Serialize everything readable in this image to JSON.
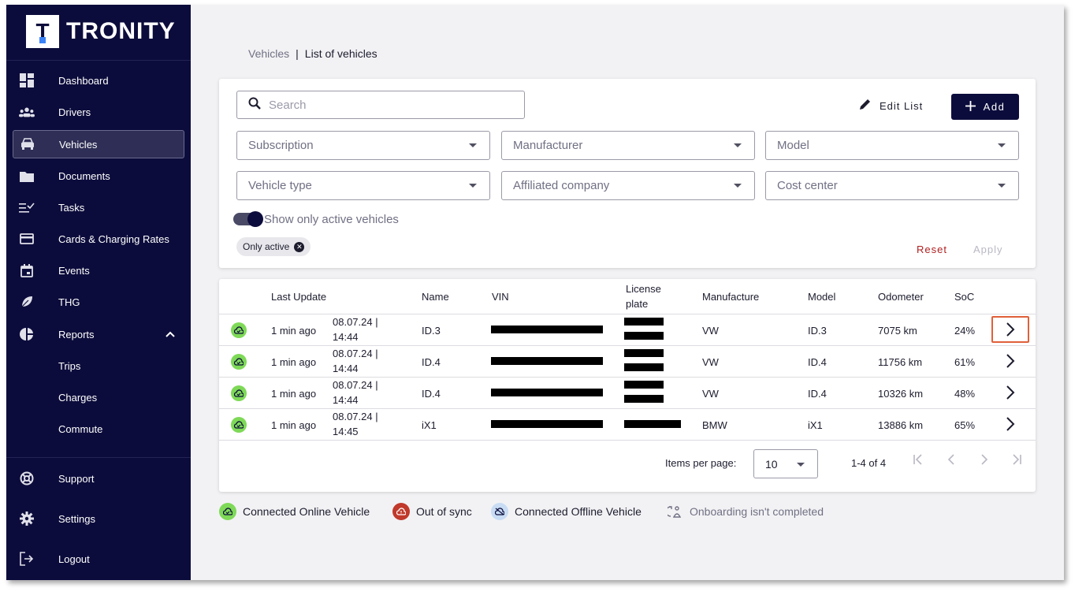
{
  "app": {
    "logo_letter": "T",
    "logo_text": "TRONITY"
  },
  "sidebar": {
    "items": [
      {
        "label": "Dashboard",
        "icon": "dashboard-icon"
      },
      {
        "label": "Drivers",
        "icon": "people-icon"
      },
      {
        "label": "Vehicles",
        "icon": "car-icon",
        "active": true
      },
      {
        "label": "Documents",
        "icon": "folder-icon"
      },
      {
        "label": "Tasks",
        "icon": "checklist-icon"
      },
      {
        "label": "Cards & Charging Rates",
        "icon": "card-icon"
      },
      {
        "label": "Events",
        "icon": "calendar-icon"
      },
      {
        "label": "THG",
        "icon": "leaf-icon"
      },
      {
        "label": "Reports",
        "icon": "pie-chart-icon",
        "expanded": true
      },
      {
        "label": "Trips"
      },
      {
        "label": "Charges"
      },
      {
        "label": "Commute"
      }
    ],
    "bottom": [
      {
        "label": "Support",
        "icon": "lifebuoy-icon"
      },
      {
        "label": "Settings",
        "icon": "gear-icon"
      },
      {
        "label": "Logout",
        "icon": "logout-icon"
      }
    ]
  },
  "breadcrumb": {
    "parent": "Vehicles",
    "separator": "|",
    "current": "List of vehicles"
  },
  "filters": {
    "search_placeholder": "Search",
    "edit_list": "Edit List",
    "add": "Add",
    "subscription": "Subscription",
    "manufacturer": "Manufacturer",
    "model": "Model",
    "vehicle_type": "Vehicle type",
    "affiliated_company": "Affiliated company",
    "cost_center": "Cost center",
    "toggle_label": "Show only active vehicles",
    "toggle_on": true,
    "chip": "Only active",
    "reset": "Reset",
    "apply": "Apply"
  },
  "table": {
    "headers": {
      "last_update": "Last Update",
      "name": "Name",
      "vin": "VIN",
      "license_line1": "License",
      "license_line2": "plate",
      "manufacture": "Manufacture",
      "model": "Model",
      "odometer": "Odometer",
      "soc": "SoC"
    },
    "rows": [
      {
        "ago": "1 min ago",
        "date": "08.07.24 |",
        "time": "14:44",
        "name": "ID.3",
        "manufacture": "VW",
        "model": "ID.3",
        "odometer": "7075 km",
        "soc": "24%"
      },
      {
        "ago": "1 min ago",
        "date": "08.07.24 |",
        "time": "14:44",
        "name": "ID.4",
        "manufacture": "VW",
        "model": "ID.4",
        "odometer": "11756 km",
        "soc": "61%"
      },
      {
        "ago": "1 min ago",
        "date": "08.07.24 |",
        "time": "14:44",
        "name": "ID.4",
        "manufacture": "VW",
        "model": "ID.4",
        "odometer": "10326 km",
        "soc": "48%"
      },
      {
        "ago": "1 min ago",
        "date": "08.07.24 |",
        "time": "14:45",
        "name": "iX1",
        "manufacture": "BMW",
        "model": "iX1",
        "odometer": "13886 km",
        "soc": "65%"
      }
    ],
    "pager": {
      "label": "Items per page:",
      "per_page": "10",
      "range": "1-4 of 4"
    }
  },
  "legend": {
    "online": "Connected Online Vehicle",
    "out_of_sync": "Out of sync",
    "offline": "Connected Offline Vehicle",
    "onboarding": "Onboarding isn't completed"
  },
  "colors": {
    "sidebar_bg": "#0c0c3c",
    "online_green": "#7ed957",
    "out_of_sync_red": "#c0392b",
    "offline_blue": "#c8dcf4",
    "reset_red": "#b02020"
  }
}
